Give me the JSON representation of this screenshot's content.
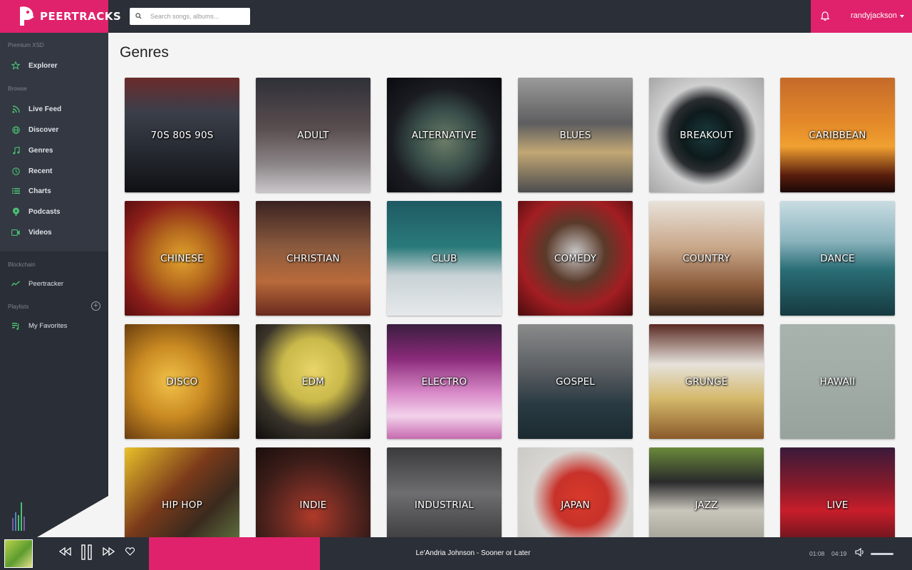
{
  "app": {
    "logo_text": "PEERTRACKS",
    "brand_color": "#e0226c",
    "bar_color": "#2b2f38"
  },
  "search": {
    "placeholder": "Search songs, albums..."
  },
  "header": {
    "username": "randyjackson"
  },
  "sidebar": {
    "section_premium": "Premium XSD",
    "explorer": "Explorer",
    "section_browse": "Browse",
    "browse_items": [
      {
        "label": "Live Feed",
        "icon": "rss-icon"
      },
      {
        "label": "Discover",
        "icon": "globe-icon"
      },
      {
        "label": "Genres",
        "icon": "music-note-icon"
      },
      {
        "label": "Recent",
        "icon": "clock-icon"
      },
      {
        "label": "Charts",
        "icon": "list-icon"
      },
      {
        "label": "Podcasts",
        "icon": "podcast-icon"
      },
      {
        "label": "Videos",
        "icon": "video-icon"
      }
    ],
    "section_blockchain": "Blockchain",
    "peertracker": "Peertracker",
    "section_playlists": "Playlists",
    "favorites": "My Favorites"
  },
  "main": {
    "title": "Genres",
    "genres": [
      {
        "label": "70S 80S 90S",
        "bg": "linear-gradient(180deg,#6a2b2b 0%,#3b3f4a 30%,#22262c 70%,#0f1014 100%)"
      },
      {
        "label": "ADULT",
        "bg": "linear-gradient(180deg,#2f3038 0%,#5a4e50 45%,#8a8486 75%,#c9c6c9 100%)"
      },
      {
        "label": "ALTERNATIVE",
        "bg": "radial-gradient(circle at 50% 55%,#6b7d68 0%,#3a4f4a 35%,#1a1c22 62%,#0a0b10 100%)"
      },
      {
        "label": "BLUES",
        "bg": "linear-gradient(180deg,#9a9a9a 0%,#5e5e60 40%,#c2a774 65%,#4c4c4e 100%)"
      },
      {
        "label": "BREAKOUT",
        "bg": "radial-gradient(circle at 50% 50%,#1a3b3d 0%,#0e1a1c 30%,#2a2d30 45%,#cfcfcf 62%,#a6a6a6 100%)"
      },
      {
        "label": "CARIBBEAN",
        "bg": "linear-gradient(180deg,#c46a2a 0%,#e48a2a 40%,#f0a030 60%,#5a1e0e 85%,#1a0806 100%)"
      },
      {
        "label": "CHINESE",
        "bg": "radial-gradient(circle at 50% 50%,#e2a32f 0%,#b56a1e 35%,#8c1f1a 70%,#5a0e10 100%)"
      },
      {
        "label": "CHRISTIAN",
        "bg": "linear-gradient(180deg,#3a2220 0%,#8a5a3e 40%,#b86a3a 70%,#6a2a1e 100%)"
      },
      {
        "label": "CLUB",
        "bg": "linear-gradient(180deg,#1e5a63 0%,#2a7a7a 40%,#c9d2d6 65%,#e6e9eb 100%)"
      },
      {
        "label": "COMEDY",
        "bg": "radial-gradient(circle at 50% 45%,#c8c8c8 0%,#5a3a2a 35%,#a21e22 65%,#4a0c0e 100%)"
      },
      {
        "label": "COUNTRY",
        "bg": "linear-gradient(180deg,#e8e2da 0%,#c9a88a 40%,#8a5a3a 75%,#3a2418 100%)"
      },
      {
        "label": "DANCE",
        "bg": "linear-gradient(180deg,#c9dde3 0%,#8ab3bd 35%,#2a6e76 60%,#163a40 100%)"
      },
      {
        "label": "DISCO",
        "bg": "radial-gradient(circle at 40% 50%,#f2c24a 0%,#c98a22 40%,#7a4a12 75%,#3a2208 100%)"
      },
      {
        "label": "EDM",
        "bg": "radial-gradient(circle at 50% 40%,#e9d56a 0%,#c9b84a 35%,#3a342a 65%,#0e0d0c 100%)"
      },
      {
        "label": "ELECTRO",
        "bg": "linear-gradient(180deg,#3a1e3e 0%,#8a2a7a 30%,#d98ac9 60%,#f2d2ea 80%,#c76ab0 100%)"
      },
      {
        "label": "GOSPEL",
        "bg": "linear-gradient(180deg,#8a8a8a 0%,#5a5e62 40%,#2a3a42 70%,#1a2a30 100%)"
      },
      {
        "label": "GRUNGE",
        "bg": "linear-gradient(180deg,#5a2a22 0%,#e6e2dc 35%,#d4b86a 65%,#8a5a2a 100%)"
      },
      {
        "label": "HAWAII",
        "bg": "linear-gradient(180deg,#a9b3ae 0%,#a2aca7 50%,#98a29d 100%)"
      },
      {
        "label": "HIP HOP",
        "bg": "linear-gradient(135deg,#e9c12a 0%,#7a3a1a 40%,#3a2a1e 65%,#6a8a4a 100%)"
      },
      {
        "label": "INDIE",
        "bg": "radial-gradient(circle at 50% 60%,#b03a2a 0%,#6a2a22 35%,#3a1c18 65%,#1a0e0c 100%)"
      },
      {
        "label": "INDUSTRIAL",
        "bg": "linear-gradient(180deg,#3a3a3c 0%,#6e6e70 40%,#4a4a4c 70%,#2a2a2c 100%)"
      },
      {
        "label": "JAPAN",
        "bg": "radial-gradient(circle at 55% 45%,#d93a2a 0%,#c8322a 30%,#d8d6d2 55%,#c9c7c3 100%)"
      },
      {
        "label": "JAZZ",
        "bg": "linear-gradient(180deg,#6a8a3a 0%,#2a2a2c 30%,#c9c6bc 55%,#8a8a7e 100%)"
      },
      {
        "label": "LIVE",
        "bg": "linear-gradient(180deg,#3a1a3a 0%,#8a1a2a 35%,#c81e2a 55%,#2a0e14 100%)"
      }
    ]
  },
  "player": {
    "now_playing": "Le'Andria Johnson - Sooner or Later",
    "current_time": "01:08",
    "total_time": "04:19",
    "progress_fraction": 0.263
  }
}
